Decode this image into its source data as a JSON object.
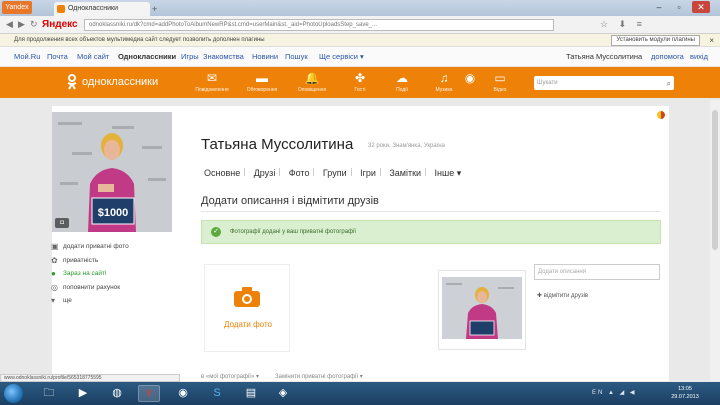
{
  "browser": {
    "menu_label": "Yandex",
    "tab_title": "Одноклассники",
    "new_tab_glyph": "+",
    "url_text": "odnoklassniki.ru/dk?cmd=addPhotoToAlbumNewRP&st.cmd=userMain&st._aid=PhotoUploadsStep_save_...",
    "yandex_logo": "Яндекс",
    "infobar_text": "Для продолжения всех объектов мультимедиа сайт следует позволить дополнен плагины",
    "infobar_button": "Установить модули плагины",
    "status_url": "www.odnoklassniki.ru/profile/565318775595"
  },
  "bookmarks": {
    "left": [
      "Мой.Ru",
      "Почта",
      "Мой сайт",
      "Одноклассники",
      "Игры",
      "Знакомства",
      "Новини",
      "Пошук",
      "Ще сервіси ▾"
    ],
    "right_name": "Татьяна Муссолитина",
    "right_links": [
      "допомога",
      "вихід"
    ]
  },
  "header": {
    "logo_text": "одноклассники",
    "nav": [
      {
        "icon": "envelope-icon",
        "glyph": "✉",
        "label": "Повідомлення"
      },
      {
        "icon": "chat-icon",
        "glyph": "▬",
        "label": "Обговорення"
      },
      {
        "icon": "bell-icon",
        "glyph": "🔔",
        "label": "Оповіщення"
      },
      {
        "icon": "guests-icon",
        "glyph": "✤",
        "label": "Гості"
      },
      {
        "icon": "events-icon",
        "glyph": "☁",
        "label": "Події"
      },
      {
        "icon": "music-icon",
        "glyph": "♫",
        "label": "Музика"
      },
      {
        "icon": "camera-icon",
        "glyph": "◉",
        "label": ""
      },
      {
        "icon": "video-icon",
        "glyph": "▭",
        "label": "Відео"
      }
    ],
    "search_placeholder": "Шукати"
  },
  "profile": {
    "name": "Татьяна Муссолитина",
    "meta": "32 роки, Знам'янка, Україна",
    "tabs": [
      "Основне",
      "Друзі",
      "Фото",
      "Групи",
      "Ігри",
      "Замітки",
      "Інше ▾"
    ],
    "avatar_sign_text": "$1000",
    "avatar_badge": "◘"
  },
  "left_menu": [
    {
      "icon": "photo-icon",
      "glyph": "▣",
      "label": "додати приватні фото",
      "status": ""
    },
    {
      "icon": "gift-icon",
      "glyph": "✿",
      "label": "приватність",
      "status": ""
    },
    {
      "icon": "online-icon",
      "glyph": "●",
      "label": "Зараз на сайті",
      "status": "online"
    },
    {
      "icon": "money-icon",
      "glyph": "◎",
      "label": "поповнити рахунок",
      "status": ""
    },
    {
      "icon": "more-icon",
      "glyph": "▾",
      "label": "ще",
      "status": ""
    }
  ],
  "main": {
    "section_title": "Додати описання і відмітити друзів",
    "notice_icon": "✓",
    "notice_text": "Фотографії додані у ваш приватні фотографії",
    "add_photo_label": "Додати фото",
    "desc_placeholder": "Додати описання",
    "tag_friends": "відмітити друзів",
    "tag_glyph": "✚",
    "bottom_links": [
      "в «мої фотографії» ▾",
      "Замінити приватні фотографії ▾"
    ]
  },
  "taskbar": {
    "apps": [
      {
        "icon": "explorer-icon",
        "glyph": "🗀"
      },
      {
        "icon": "media-player-icon",
        "glyph": "▶"
      },
      {
        "icon": "firefox-icon",
        "glyph": "◍"
      },
      {
        "icon": "yandex-browser-icon",
        "glyph": "Y"
      },
      {
        "icon": "chrome-icon",
        "glyph": "◉"
      },
      {
        "icon": "skype-icon",
        "glyph": "S"
      },
      {
        "icon": "folder-icon",
        "glyph": "▤"
      },
      {
        "icon": "app-icon",
        "glyph": "◈"
      }
    ],
    "tray_text": "EN ▲ ◢ ◀",
    "clock_time": "13:05",
    "clock_date": "29.07.2013"
  },
  "colors": {
    "brand_orange": "#ee8208",
    "notice_green": "#d9efcf",
    "online_green": "#2a9a2a",
    "taskbar_blue": "#1b3f62"
  }
}
